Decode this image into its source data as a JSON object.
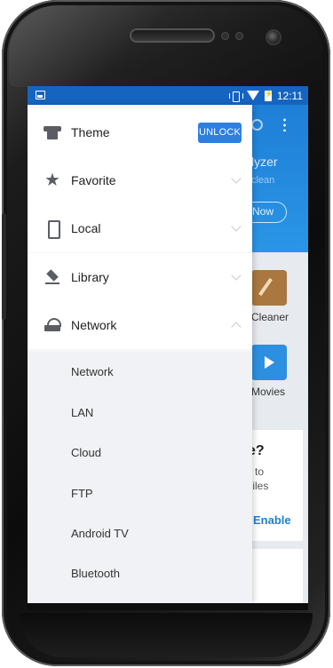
{
  "status_bar": {
    "time": "12:11"
  },
  "drawer": {
    "items": [
      {
        "label": "Theme",
        "icon": "shirt-icon",
        "button": "UNLOCK"
      },
      {
        "label": "Favorite",
        "icon": "star-icon"
      },
      {
        "label": "Local",
        "icon": "phone-icon"
      },
      {
        "label": "Library",
        "icon": "layers-icon"
      },
      {
        "label": "Network",
        "icon": "router-icon",
        "expanded": true
      }
    ],
    "network_sub_items": [
      {
        "label": "Network"
      },
      {
        "label": "LAN"
      },
      {
        "label": "Cloud"
      },
      {
        "label": "FTP"
      },
      {
        "label": "Android TV"
      },
      {
        "label": "Bluetooth"
      }
    ]
  },
  "background_app": {
    "header_title_fragment": "lyzer",
    "header_sub_fragment": "clean",
    "now_button": "Now",
    "cleaner_label": "Cleaner",
    "movies_label": "Movies",
    "card_question": "e?",
    "card_line1": "to",
    "card_line2": "Files",
    "card_action": "Enable"
  },
  "colors": {
    "status_bar": "#1565c0",
    "accent": "#2d7fe0",
    "drawer_bg": "#ffffff",
    "sub_list_bg": "#f0f2f5"
  }
}
